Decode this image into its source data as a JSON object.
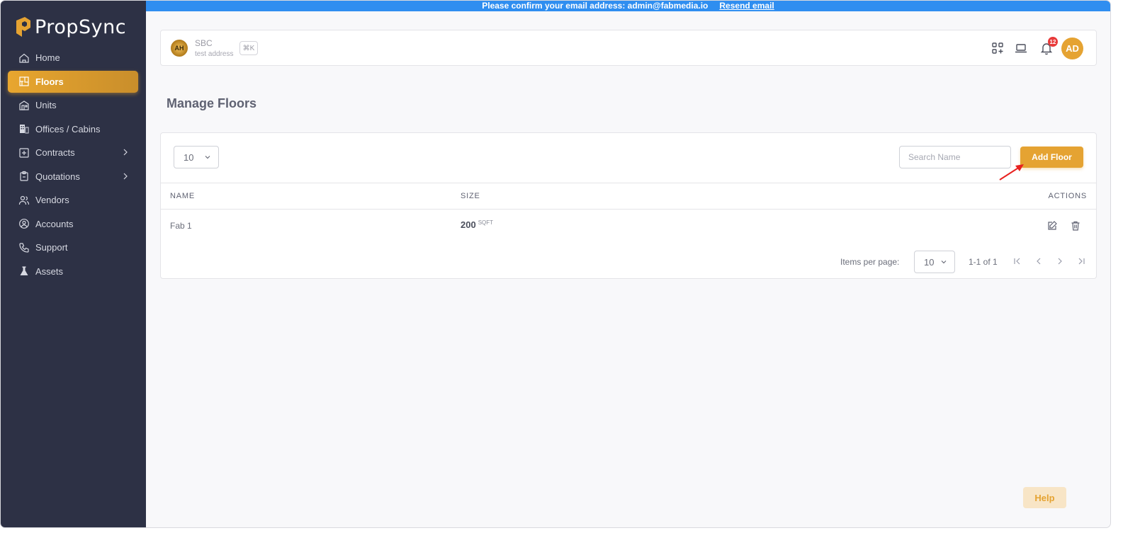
{
  "brand": {
    "name": "PropSync",
    "accent": "#e5a332",
    "sidebar_bg": "#2d3145"
  },
  "banner": {
    "message": "Please confirm your email address: admin@fabmedia.io",
    "link": "Resend email",
    "color": "#2f8ef0"
  },
  "sidebar": {
    "items": [
      {
        "label": "Home",
        "icon": "home-icon"
      },
      {
        "label": "Floors",
        "icon": "floor-plan-icon",
        "active": true
      },
      {
        "label": "Units",
        "icon": "units-icon"
      },
      {
        "label": "Offices / Cabins",
        "icon": "building-icon"
      },
      {
        "label": "Contracts",
        "icon": "contract-icon",
        "expandable": true
      },
      {
        "label": "Quotations",
        "icon": "clipboard-icon",
        "expandable": true
      },
      {
        "label": "Vendors",
        "icon": "users-icon"
      },
      {
        "label": "Accounts",
        "icon": "account-icon"
      },
      {
        "label": "Support",
        "icon": "phone-icon"
      },
      {
        "label": "Assets",
        "icon": "flask-icon"
      }
    ]
  },
  "header": {
    "company_logo_text": "AH",
    "company_name": "SBC",
    "company_address": "test address",
    "shortcut": "⌘K",
    "notification_count": "12",
    "avatar_initials": "AD"
  },
  "page": {
    "title": "Manage Floors"
  },
  "table": {
    "page_size": "10",
    "search_placeholder": "Search Name",
    "add_button": "Add Floor",
    "columns": {
      "name": "NAME",
      "size": "SIZE",
      "actions": "ACTIONS"
    },
    "rows": [
      {
        "name": "Fab 1",
        "size": "200",
        "unit": "SQFT"
      }
    ],
    "pagination": {
      "items_per_page_label": "Items per page:",
      "items_per_page": "10",
      "range": "1-1 of 1"
    }
  },
  "help_button": "Help"
}
